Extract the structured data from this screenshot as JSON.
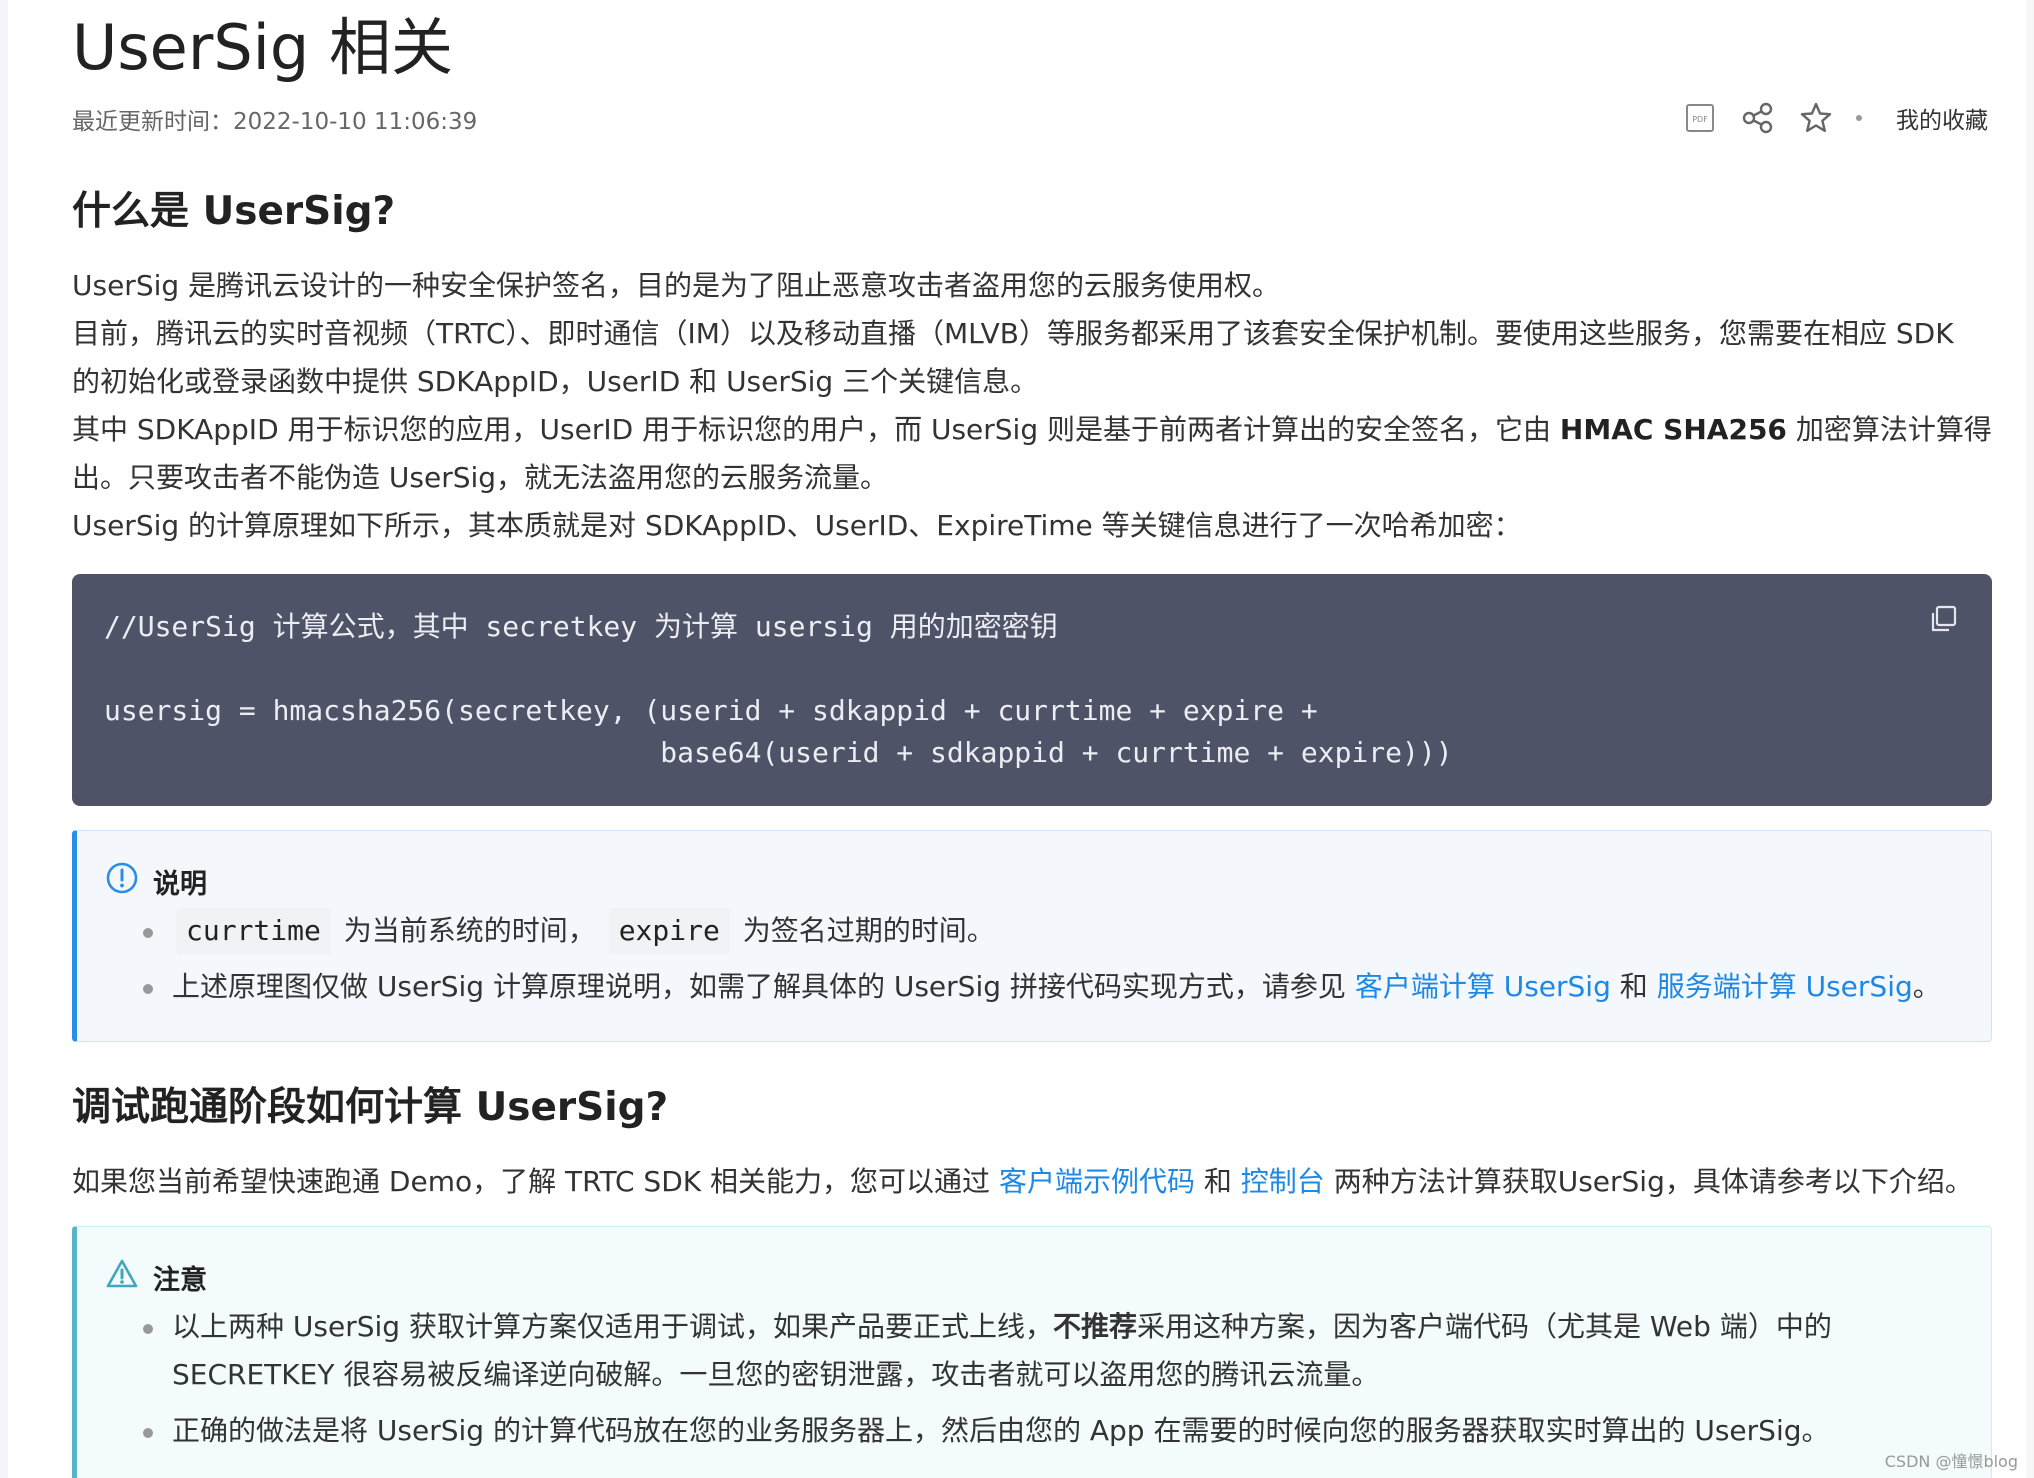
{
  "header": {
    "title": "UserSig 相关",
    "updated": "最近更新时间：2022-10-10 11:06:39",
    "fav_label": "我的收藏",
    "icons": [
      "pdf-icon",
      "share-icon",
      "star-icon"
    ]
  },
  "section1": {
    "heading": "什么是 UserSig?",
    "lines": [
      "UserSig 是腾讯云设计的一种安全保护签名，目的是为了阻止恶意攻击者盗用您的云服务使用权。",
      "目前，腾讯云的实时音视频（TRTC）、即时通信（IM）以及移动直播（MLVB）等服务都采用了该套安全保护机制。要使用这些服务，您需要在相应 SDK",
      "的初始化或登录函数中提供 SDKAppID，UserID 和 UserSig 三个关键信息。",
      "其中 SDKAppID 用于标识您的应用，UserID 用于标识您的用户，而 UserSig 则是基于前两者计算出的安全签名，它由",
      "HMAC SHA256",
      "加密算法计算得",
      "出。只要攻击者不能伪造 UserSig，就无法盗用您的云服务流量。",
      "UserSig 的计算原理如下所示，其本质就是对 SDKAppID、UserID、ExpireTime 等关键信息进行了一次哈希加密："
    ]
  },
  "code": {
    "lines": [
      "//UserSig 计算公式，其中 secretkey 为计算 usersig 用的加密密钥",
      "",
      "usersig = hmacsha256(secretkey, (userid + sdkappid + currtime + expire +",
      "                                 base64(userid + sdkappid + currtime + expire)))"
    ]
  },
  "note": {
    "title": "说明",
    "item1_code1": "currtime",
    "item1_text1": "为当前系统的时间，",
    "item1_code2": "expire",
    "item1_text2": "为签名过期的时间。",
    "item2_text1": "上述原理图仅做 UserSig 计算原理说明，如需了解具体的 UserSig 拼接代码实现方式，请参见",
    "item2_link1": "客户端计算 UserSig",
    "item2_text2": "和",
    "item2_link2": "服务端计算 UserSig",
    "item2_text3": "。"
  },
  "section2": {
    "heading": "调试跑通阶段如何计算 UserSig?",
    "text1": "如果您当前希望快速跑通 Demo，了解 TRTC SDK 相关能力，您可以通过",
    "link1": "客户端示例代码",
    "text2": "和",
    "link2": "控制台",
    "text3": "两种方法计算获取UserSig，具体请参考以下介绍。"
  },
  "warning": {
    "title": "注意",
    "item1_text1": "以上两种 UserSig 获取计算方案仅适用于调试，如果产品要正式上线，",
    "item1_bold": "不推荐",
    "item1_text2": "采用这种方案，因为客户端代码（尤其是 Web 端）中的",
    "item1_line2": "SECRETKEY 很容易被反编译逆向破解。一旦您的密钥泄露，攻击者就可以盗用您的腾讯云流量。",
    "item2_text": "正确的做法是将 UserSig 的计算代码放在您的业务服务器上，然后由您的 App 在需要的时候向您的服务器获取实时算出的 UserSig。"
  },
  "watermark": "CSDN @憧憬blog",
  "colors": {
    "link": "#1e88e5",
    "code_bg": "#4f5368",
    "note_border": "#2b8ee6",
    "warn_border": "#5ab3c6"
  }
}
